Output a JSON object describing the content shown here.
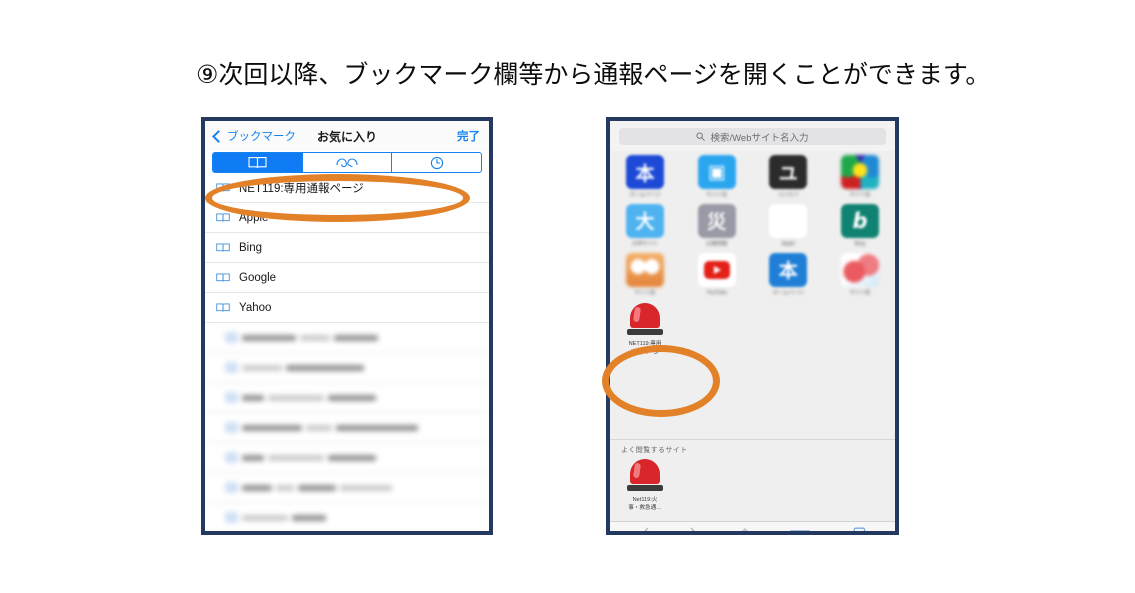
{
  "heading": "⑨次回以降、ブックマーク欄等から通報ページを開くことができます。",
  "colors": {
    "accent_blue": "#0f7bf5",
    "link_blue": "#1682ef",
    "highlight_orange": "#e38128",
    "frame_navy": "#23395f",
    "siren_red": "#d8262b"
  },
  "bookmarks_screen": {
    "navbar": {
      "back_label": "ブックマーク",
      "title": "お気に入り",
      "done_label": "完了"
    },
    "segments": [
      {
        "icon": "book-icon",
        "selected": true
      },
      {
        "icon": "reading-glasses-icon",
        "selected": false
      },
      {
        "icon": "clock-icon",
        "selected": false
      }
    ],
    "items": [
      {
        "label": "NET119:専用通報ページ",
        "blurred": false,
        "highlighted": true
      },
      {
        "label": "Apple",
        "blurred": false,
        "highlighted": false
      },
      {
        "label": "Bing",
        "blurred": false,
        "highlighted": false
      },
      {
        "label": "Google",
        "blurred": false,
        "highlighted": false
      },
      {
        "label": "Yahoo",
        "blurred": false,
        "highlighted": false
      },
      {
        "label": "",
        "blurred": true,
        "highlighted": false
      },
      {
        "label": "",
        "blurred": true,
        "highlighted": false
      },
      {
        "label": "",
        "blurred": true,
        "highlighted": false
      },
      {
        "label": "",
        "blurred": true,
        "highlighted": false
      },
      {
        "label": "",
        "blurred": true,
        "highlighted": false
      },
      {
        "label": "",
        "blurred": true,
        "highlighted": false
      },
      {
        "label": "",
        "blurred": true,
        "highlighted": false
      }
    ]
  },
  "favorites_screen": {
    "search": {
      "placeholder": "検索/Webサイト名入力",
      "icon": "search-icon"
    },
    "grid_rows": [
      [
        {
          "glyph": "本",
          "bg": "#1c49d6",
          "caption": "ホームページ",
          "blurred": true
        },
        {
          "glyph": "▣",
          "bg": "#2aa6ef",
          "caption": "サイト名",
          "blurred": true
        },
        {
          "glyph": "ユ",
          "bg": "#2b2b2b",
          "caption": "ユニセフ",
          "blurred": true
        },
        {
          "glyph": "",
          "bg": "#3a1ea8",
          "caption": "サイト名",
          "blurred": true
        }
      ],
      [
        {
          "glyph": "大",
          "bg": "#4fb3f0",
          "caption": "大学サイト",
          "blurred": true
        },
        {
          "glyph": "災",
          "bg": "#9a9aa6",
          "caption": "災害情報",
          "blurred": true
        },
        {
          "glyph": "",
          "bg": "#ffffff",
          "caption": "Apple",
          "blurred": true
        },
        {
          "glyph": "b",
          "bg": "#108272",
          "caption": "Bing",
          "blurred": true
        }
      ],
      [
        {
          "glyph": "",
          "bg": "#f0a04a",
          "caption": "サイト名",
          "blurred": true
        },
        {
          "glyph": "▶",
          "bg": "#ffffff",
          "caption": "YouTube",
          "blurred": true
        },
        {
          "glyph": "本",
          "bg": "#1f7fd6",
          "caption": "ホームページ",
          "blurred": true
        },
        {
          "glyph": "",
          "bg": "#ffffff",
          "caption": "サイト名",
          "blurred": true
        }
      ]
    ],
    "net119_tile": {
      "icon": "siren-icon",
      "caption_line1": "NET119:専用",
      "caption_line2": "通報ページ"
    },
    "frequent_section": {
      "heading": "よく閲覧するサイト",
      "tile": {
        "icon": "siren-icon",
        "caption_line1": "Net119:火",
        "caption_line2": "事・救急通…"
      }
    },
    "toolbar": [
      {
        "icon": "back-chevron-icon",
        "enabled": false
      },
      {
        "icon": "forward-chevron-icon",
        "enabled": false
      },
      {
        "icon": "share-icon",
        "enabled": false
      },
      {
        "icon": "bookmarks-book-icon",
        "enabled": true
      },
      {
        "icon": "tabs-icon",
        "enabled": true
      }
    ]
  }
}
